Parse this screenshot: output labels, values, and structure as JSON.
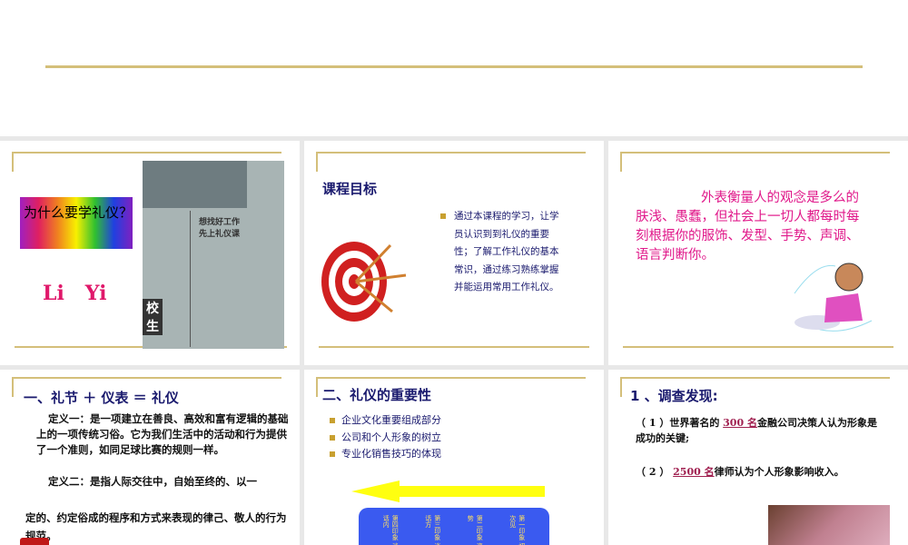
{
  "slide1": {
    "question": "为什么要学礼仪？",
    "pinyin": "Li   Yi",
    "newspaper_headline": "想找好工作先上礼仪课",
    "newspaper_side": "校 生"
  },
  "slide2": {
    "title": "课程目标",
    "bullet": "通过本课程的学习，让学员认识到到礼仪的重要性；了解工作礼仪的基本常识，通过练习熟练掌握并能运用常用工作礼仪。"
  },
  "slide3": {
    "text": "外表衡量人的观念是多么的肤浅、愚蠢，但社会上一切人都每时每刻根据你的服饰、发型、手势、声调、语言判断你。"
  },
  "slide4": {
    "title": "一、礼节 ＋ 仪表 ＝ 礼仪",
    "def1": "定义一：是一项建立在善良、高效和富有逻辑的基础上的一项传统习俗。它为我们生活中的活动和行为提供了一个准则，如同足球比赛的规则一样。",
    "def2": "定义二：是指人际交往中，自始至终的、以一",
    "def2b": "定的、约定俗成的程序和方式来表现的律己、敬人的行为规范。"
  },
  "slide5": {
    "title": "二、礼仪的重要性",
    "bullets": [
      "企业文化重要组成部分",
      "公司和个人形象的树立",
      "专业化销售技巧的体现"
    ],
    "box_columns": [
      "第一印象 初次见",
      "第二印象 姿势",
      "第三印象 谈话方",
      "第四印象 谈话内"
    ]
  },
  "slide6": {
    "title": "1 、调查发现:",
    "item1_prefix": "（ 1 ）世界著名的 ",
    "item1_num": "300 名",
    "item1_suffix": "金融公司决策人认为形象是成功的关键;",
    "item2_prefix": "（ 2 ） ",
    "item2_num": "2500 名",
    "item2_suffix": "律师认为个人形象影响收入。"
  }
}
